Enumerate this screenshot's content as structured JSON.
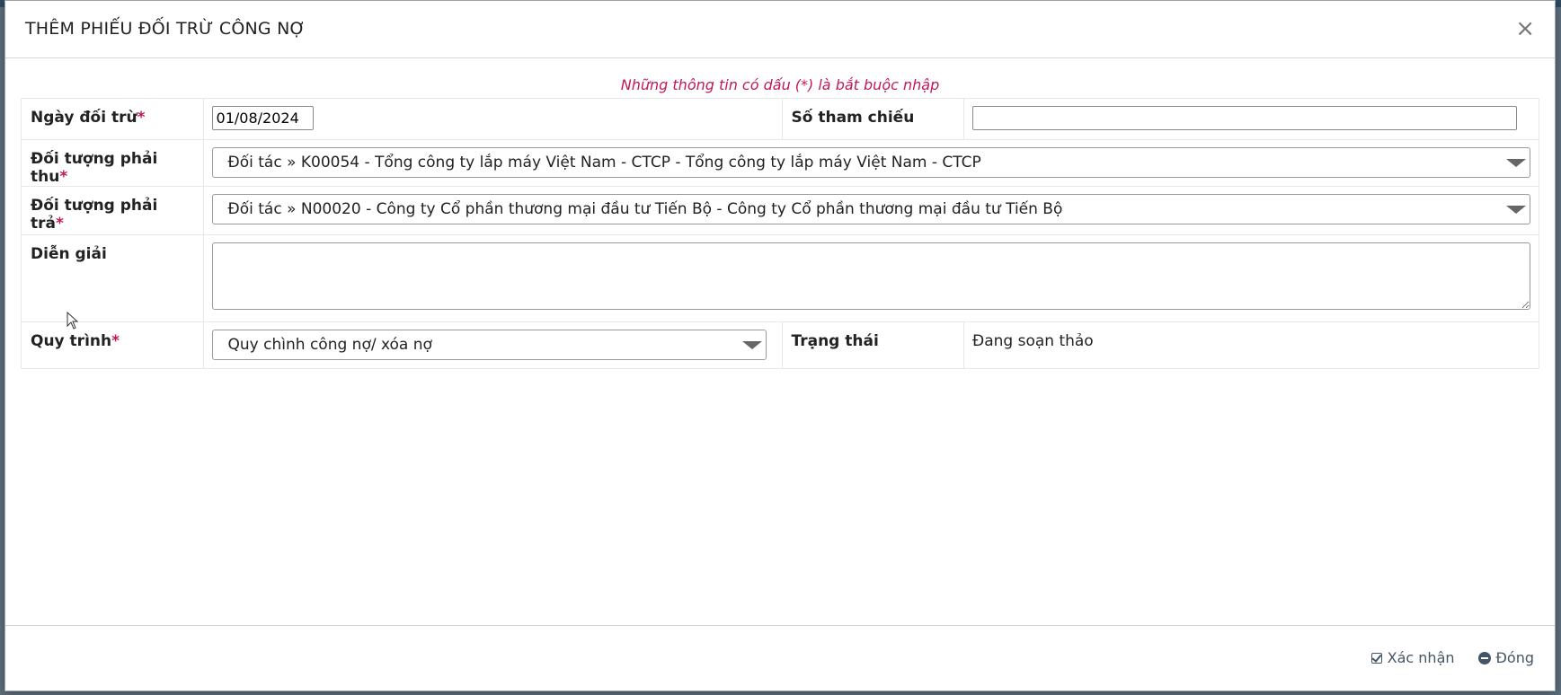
{
  "dialog": {
    "title": "THÊM PHIẾU ĐỐI TRỪ CÔNG NỢ",
    "close_symbol": "×",
    "required_note": "Những thông tin có dấu (*) là bắt buộc nhập"
  },
  "form": {
    "offset_date": {
      "label": "Ngày đối trừ",
      "required_mark": "*",
      "value": "01/08/2024"
    },
    "reference_no": {
      "label": "Số tham chiếu",
      "value": ""
    },
    "receivable_party": {
      "label": "Đối tượng phải thu",
      "required_mark": "*",
      "value": "Đối tác » K00054 - Tổng công ty lắp máy Việt Nam - CTCP - Tổng công ty lắp máy Việt Nam - CTCP"
    },
    "payable_party": {
      "label": "Đối tượng phải trả",
      "required_mark": "*",
      "value": "Đối tác » N00020 - Công ty Cổ phần thương mại đầu tư Tiến Bộ - Công ty Cổ phần thương mại đầu tư Tiến Bộ"
    },
    "description": {
      "label": "Diễn giải",
      "value": ""
    },
    "workflow": {
      "label": "Quy trình",
      "required_mark": "*",
      "value": "Quy chình công nợ/ xóa nợ"
    },
    "status": {
      "label": "Trạng thái",
      "value": "Đang soạn thảo"
    }
  },
  "footer": {
    "confirm_label": "Xác nhận",
    "close_label": "Đóng"
  },
  "colors": {
    "required": "#c2185b",
    "footer_text": "#445566"
  }
}
